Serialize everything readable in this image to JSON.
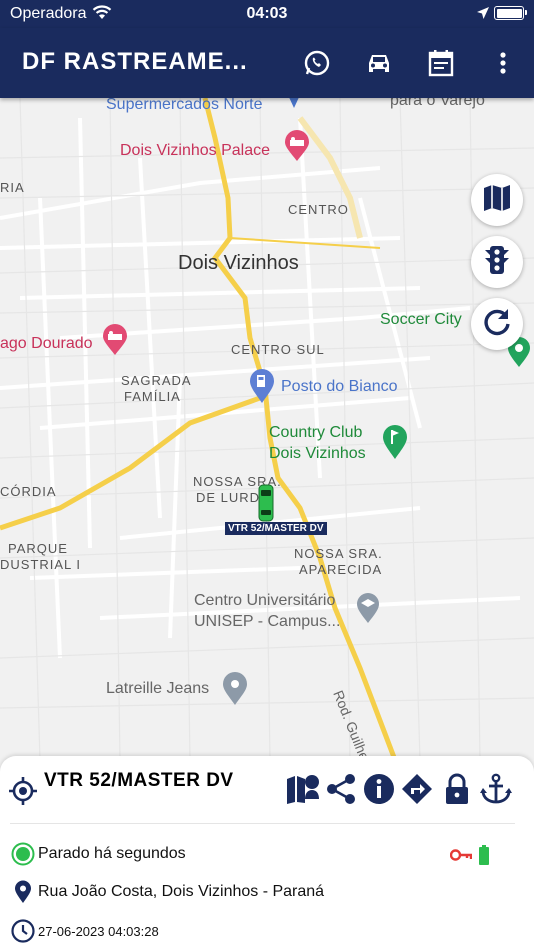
{
  "status_bar": {
    "carrier": "Operadora",
    "time": "04:03"
  },
  "app_bar": {
    "title": "DF RASTREAME...",
    "icons": [
      "whatsapp-icon",
      "car-icon",
      "calendar-icon",
      "more-vert-icon"
    ]
  },
  "map": {
    "labels": {
      "supermercados": "Supermercados Norte",
      "varejo": "para o Varejo",
      "palace": "Dois Vizinhos Palace",
      "ria": "RIA",
      "centro": "CENTRO",
      "city": "Dois Vizinhos",
      "soccer": "Soccer City",
      "ago_dourado": "ago Dourado",
      "centro_sul": "CENTRO SUL",
      "sagrada_1": "SAGRADA",
      "sagrada_2": "FAMÍLIA",
      "posto": "Posto do Bianco",
      "country_1": "Country Club",
      "country_2": "Dois Vizinhos",
      "nossa_lurdes_1": "NOSSA SRA.",
      "nossa_lurdes_2": "DE LURD",
      "cordia": "CÓRDIA",
      "parque_1": "PARQUE",
      "parque_2": "DUSTRIAL I",
      "nossa_aparecida_1": "NOSSA SRA.",
      "nossa_aparecida_2": "APARECIDA",
      "unisep_1": "Centro Universitário",
      "unisep_2": "UNISEP - Campus...",
      "latreille": "Latreille Jeans",
      "road": "Rod. Guilherme Ka"
    },
    "vehicle_tag": "VTR 52/MASTER DV",
    "fabs": [
      "map-icon",
      "traffic-light-icon",
      "refresh-icon"
    ]
  },
  "sheet": {
    "vehicle_name": "VTR 52/MASTER DV",
    "status": "Parado há segundos",
    "address": "Rua João Costa, Dois Vizinhos - Paraná",
    "timestamp": "27-06-2023 04:03:28"
  },
  "colors": {
    "primary": "#1a2b5e",
    "status_green": "#2dbd4e",
    "ignition_red": "#e53935",
    "battery_green": "#2dbd4e"
  }
}
